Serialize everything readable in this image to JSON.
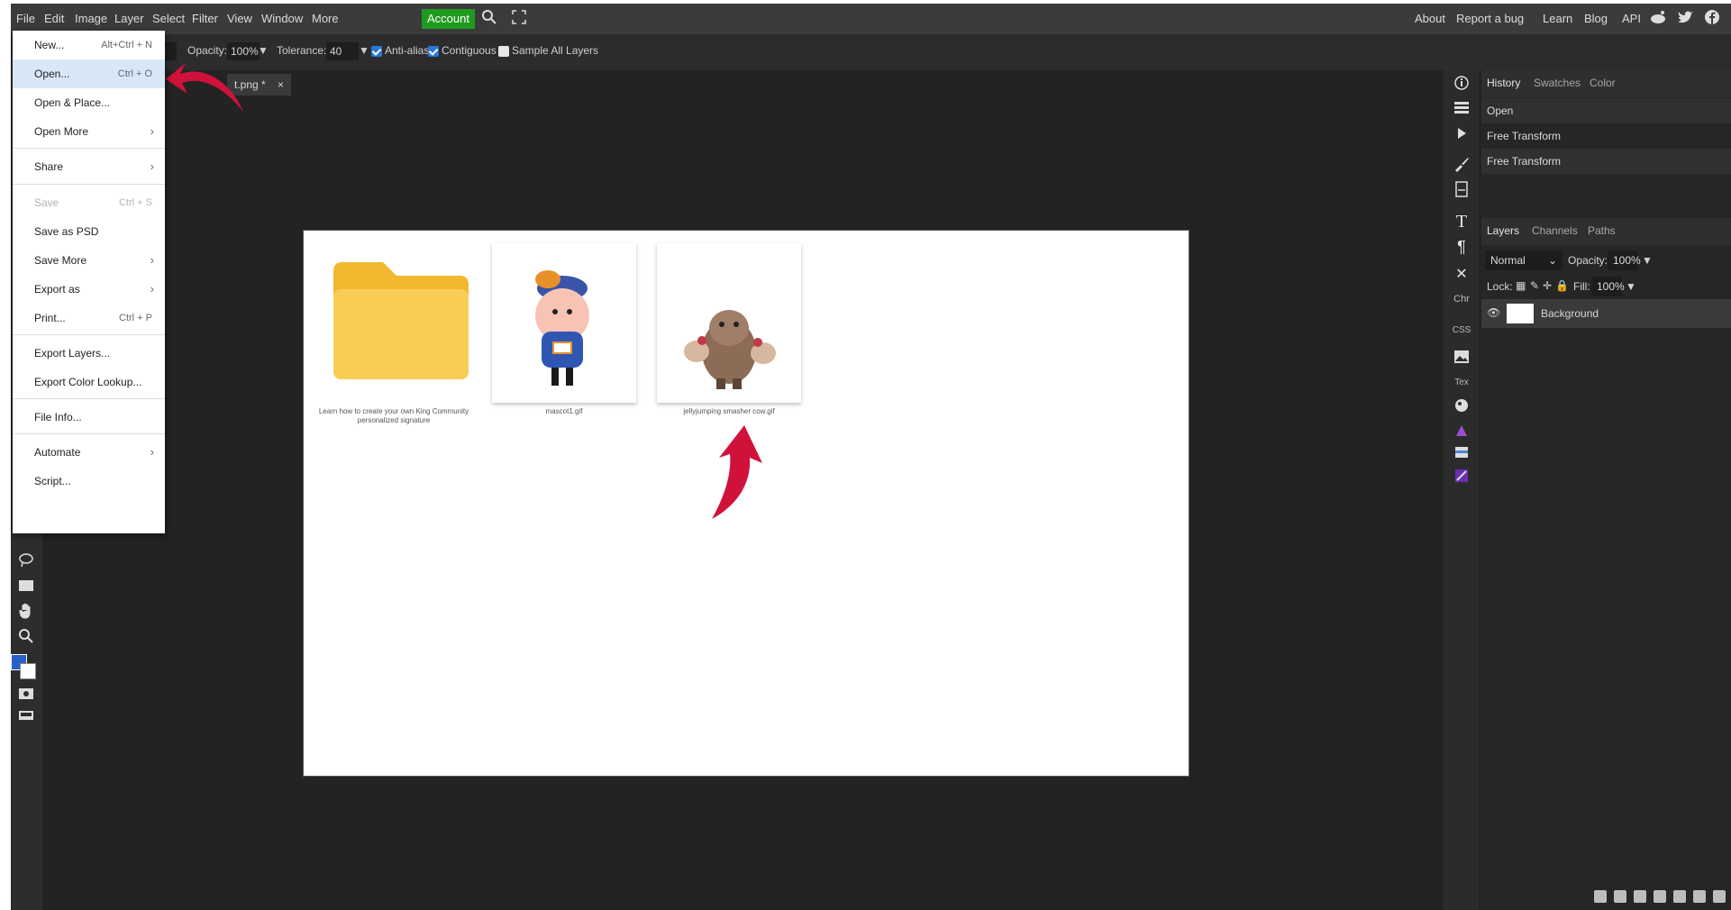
{
  "menubar": {
    "items": [
      "File",
      "Edit",
      "Image",
      "Layer",
      "Select",
      "Filter",
      "View",
      "Window",
      "More"
    ],
    "account": "Account",
    "right_links": [
      "About",
      "Report a bug",
      "Learn",
      "Blog",
      "API"
    ]
  },
  "options_bar": {
    "opacity_label": "Opacity:",
    "opacity_value": "100%",
    "tolerance_label": "Tolerance:",
    "tolerance_value": "40",
    "antialias_label": "Anti-alias",
    "contiguous_label": "Contiguous",
    "sample_all_label": "Sample All Layers"
  },
  "document_tab": {
    "name": "t.png *",
    "close": "×"
  },
  "file_menu": {
    "items": [
      {
        "label": "New...",
        "shortcut": "Alt+Ctrl + N"
      },
      {
        "label": "Open...",
        "shortcut": "Ctrl + O"
      },
      {
        "label": "Open & Place..."
      },
      {
        "label": "Open More"
      },
      {
        "label": "Share"
      },
      {
        "label": "Save",
        "shortcut": "Ctrl + S"
      },
      {
        "label": "Save as PSD"
      },
      {
        "label": "Save More"
      },
      {
        "label": "Export as"
      },
      {
        "label": "Print...",
        "shortcut": "Ctrl + P"
      },
      {
        "label": "Export Layers..."
      },
      {
        "label": "Export Color Lookup..."
      },
      {
        "label": "File Info..."
      },
      {
        "label": "Automate"
      },
      {
        "label": "Script..."
      }
    ],
    "submenu_arrow": "›"
  },
  "canvas": {
    "files": [
      {
        "caption": "Learn how to create your own King Community personalized signature"
      },
      {
        "caption": "mascot1.gif"
      },
      {
        "caption": "jellyjumping smasher cow.gif"
      }
    ]
  },
  "sidebar": {
    "labels": [
      "Chr",
      "CSS",
      "Tex"
    ]
  },
  "history_panel": {
    "tabs": [
      "History",
      "Swatches",
      "Color"
    ],
    "entries": [
      "Open",
      "Free Transform",
      "Free Transform"
    ]
  },
  "layers_panel": {
    "tabs": [
      "Layers",
      "Channels",
      "Paths"
    ],
    "blend_mode": "Normal",
    "opacity_label": "Opacity:",
    "opacity_value": "100%",
    "lock_label": "Lock:",
    "fill_label": "Fill:",
    "fill_value": "100%",
    "layer_name": "Background",
    "visibility": "👁"
  },
  "colors": {
    "menubar": "#3b3b3b",
    "account_bg": "#1f9a1f",
    "foreground": "#2a5fc9",
    "background_swatch": "#ffffff",
    "arrow": "#d0123a",
    "folder": "#f7c647"
  },
  "icons": [
    "search-icon",
    "fullscreen-icon",
    "reddit-icon",
    "twitter-icon",
    "facebook-icon",
    "lasso-icon",
    "marquee-icon",
    "hand-icon",
    "zoom-icon",
    "quick-mask-icon",
    "screen-mode-icon",
    "info-icon",
    "history-icon",
    "play-icon",
    "brush-icon",
    "document-icon",
    "type-icon",
    "paragraph-icon",
    "tools-icon",
    "image-icon",
    "globe-icon",
    "triangle-icon",
    "gallery-icon",
    "gradient-icon"
  ]
}
